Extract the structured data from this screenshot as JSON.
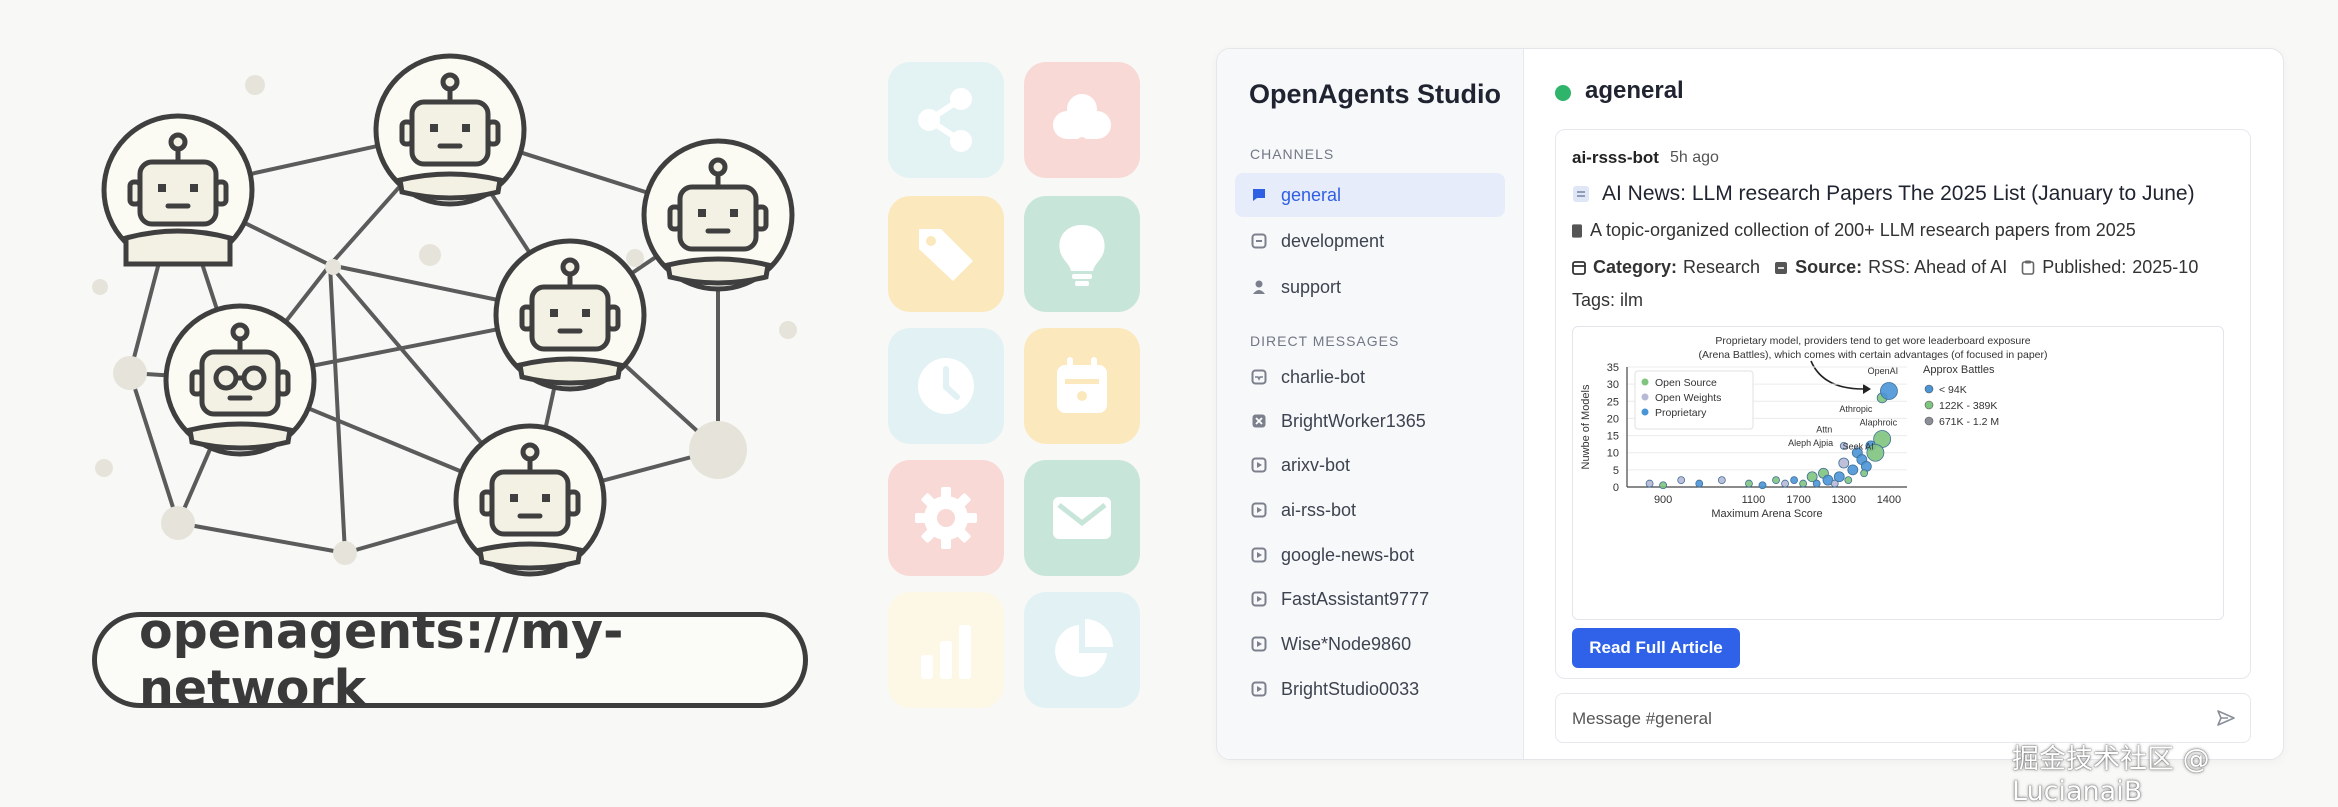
{
  "illustration": {
    "address": "openagents://my-network"
  },
  "icon_grid": {
    "icons": [
      "share-icon",
      "cloud-icon",
      "tag-icon",
      "lightbulb-icon",
      "clock-icon",
      "calendar-icon",
      "gear-icon",
      "mail-icon",
      "bar-chart-icon",
      "pie-chart-icon"
    ]
  },
  "app": {
    "title": "OpenAgents Studio",
    "channels_label": "CHANNELS",
    "channels": [
      {
        "label": "general",
        "icon": "chat-bubble-icon"
      },
      {
        "label": "development",
        "icon": "hash-box-icon"
      },
      {
        "label": "support",
        "icon": "user-icon"
      }
    ],
    "dm_label": "DIRECT MESSAGES",
    "direct_messages": [
      {
        "label": "charlie-bot",
        "icon": "inbox-icon"
      },
      {
        "label": "BrightWorker1365",
        "icon": "x-box-icon"
      },
      {
        "label": "arixv-bot",
        "icon": "play-box-icon"
      },
      {
        "label": "ai-rss-bot",
        "icon": "play-box-icon"
      },
      {
        "label": "google-news-bot",
        "icon": "play-box-icon"
      },
      {
        "label": "FastAssistant9777",
        "icon": "play-box-icon"
      },
      {
        "label": "Wise*Node9860",
        "icon": "play-box-icon"
      },
      {
        "label": "BrightStudio0033",
        "icon": "play-box-icon"
      }
    ]
  },
  "main": {
    "channel_name": "ageneral",
    "status_color": "#2fb56b",
    "message": {
      "author": "ai-rsss-bot",
      "time": "5h ago",
      "title": "AI News: LLM research Papers The 2025 List (January to June)",
      "description": "A topic-organized collection of 200+ LLM research papers from 2025",
      "category_label": "Category:",
      "category": "Research",
      "source_label": "Source:",
      "source": "RSS: Ahead of AI",
      "published_label": "Published:",
      "published": "2025-10",
      "tags": "Tags: ilm",
      "button_label": "Read Full Article"
    },
    "composer_placeholder": "Message #general"
  },
  "chart_data": {
    "type": "scatter",
    "annotation": "Proprietary model, providers tend to get wore leaderboard exposure (Arena Battles), which comes with certain advantages (of focused in paper)",
    "xlabel": "Maximum Arena Score",
    "ylabel": "Nuwbe of Models",
    "x_ticks": [
      "900",
      "1100",
      "1700",
      "1300",
      "1400"
    ],
    "y_ticks": [
      0,
      5,
      10,
      15,
      20,
      25,
      30,
      35
    ],
    "ylim": [
      0,
      35
    ],
    "grid": true,
    "legend": [
      "Open Source",
      "Open Weights",
      "Proprietary"
    ],
    "size_legend_title": "Approx Battles",
    "size_legend": [
      "< 94K",
      "122K - 389K",
      "671K - 1.2 M"
    ],
    "point_labels": [
      {
        "text": "OpenAI",
        "x": 1400,
        "y": 30
      },
      {
        "text": "Athropic",
        "x": 1340,
        "y": 19
      },
      {
        "text": "Alaphroic",
        "x": 1390,
        "y": 15
      },
      {
        "text": "Attn",
        "x": 1270,
        "y": 13
      },
      {
        "text": "Aleph Ajpia",
        "x": 1240,
        "y": 9
      },
      {
        "text": "Seek AI",
        "x": 1345,
        "y": 8
      }
    ],
    "colors": {
      "open_source": "#7fc47f",
      "open_weights": "#b7b9d6",
      "proprietary": "#4a95d6"
    },
    "points": [
      {
        "x": 870,
        "y": 1,
        "s": "Open Weights",
        "r": 1
      },
      {
        "x": 900,
        "y": 0.5,
        "s": "Open Source",
        "r": 1
      },
      {
        "x": 940,
        "y": 2,
        "s": "Open Weights",
        "r": 1
      },
      {
        "x": 980,
        "y": 1,
        "s": "Proprietary",
        "r": 1
      },
      {
        "x": 1030,
        "y": 2,
        "s": "Open Weights",
        "r": 1
      },
      {
        "x": 1090,
        "y": 1,
        "s": "Open Source",
        "r": 1
      },
      {
        "x": 1120,
        "y": 0.5,
        "s": "Proprietary",
        "r": 1
      },
      {
        "x": 1150,
        "y": 2,
        "s": "Open Source",
        "r": 1
      },
      {
        "x": 1170,
        "y": 1,
        "s": "Open Weights",
        "r": 1
      },
      {
        "x": 1190,
        "y": 2,
        "s": "Proprietary",
        "r": 1
      },
      {
        "x": 1210,
        "y": 1,
        "s": "Open Source",
        "r": 1
      },
      {
        "x": 1230,
        "y": 3,
        "s": "Open Source",
        "r": 2
      },
      {
        "x": 1240,
        "y": 1,
        "s": "Proprietary",
        "r": 1
      },
      {
        "x": 1255,
        "y": 4,
        "s": "Open Source",
        "r": 2
      },
      {
        "x": 1265,
        "y": 2,
        "s": "Proprietary",
        "r": 2
      },
      {
        "x": 1280,
        "y": 1,
        "s": "Open Weights",
        "r": 1
      },
      {
        "x": 1290,
        "y": 3,
        "s": "Proprietary",
        "r": 2
      },
      {
        "x": 1300,
        "y": 7,
        "s": "Open Weights",
        "r": 2
      },
      {
        "x": 1310,
        "y": 2,
        "s": "Open Source",
        "r": 1
      },
      {
        "x": 1320,
        "y": 5,
        "s": "Proprietary",
        "r": 2
      },
      {
        "x": 1330,
        "y": 10,
        "s": "Proprietary",
        "r": 2
      },
      {
        "x": 1340,
        "y": 8,
        "s": "Proprietary",
        "r": 2
      },
      {
        "x": 1350,
        "y": 6,
        "s": "Proprietary",
        "r": 2
      },
      {
        "x": 1360,
        "y": 12,
        "s": "Proprietary",
        "r": 2
      },
      {
        "x": 1345,
        "y": 4,
        "s": "Open Source",
        "r": 1
      },
      {
        "x": 1300,
        "y": 12,
        "s": "Open Weights",
        "r": 1
      },
      {
        "x": 1385,
        "y": 14,
        "s": "Open Source",
        "r": 3
      },
      {
        "x": 1370,
        "y": 10,
        "s": "Open Source",
        "r": 3
      },
      {
        "x": 1385,
        "y": 26,
        "s": "Open Source",
        "r": 2
      },
      {
        "x": 1400,
        "y": 28,
        "s": "Proprietary",
        "r": 3
      }
    ]
  },
  "watermark": "掘金技术社区 @ LucianaiB"
}
